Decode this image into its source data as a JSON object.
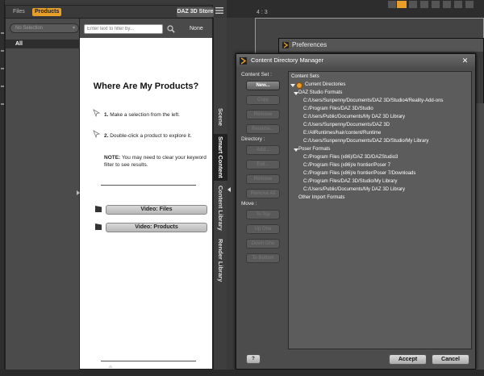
{
  "pane": {
    "tabs": {
      "files": "Files",
      "products": "Products"
    },
    "store_button": "DAZ 3D Store",
    "no_selection": "No Selection",
    "all_label": "All",
    "filter_placeholder": "Enter text to filter by...",
    "none_label": "None",
    "title": "Where Are My Products?",
    "step1": {
      "num": "1.",
      "text": "Make a selection from the left."
    },
    "step2": {
      "num": "2.",
      "text": "Double-click a product to explore it."
    },
    "note": {
      "label": "NOTE:",
      "text": "You may need to clear your keyword filter to see results."
    },
    "video_files": "Video: Files",
    "video_products": "Video: Products"
  },
  "side_tabs": [
    "Scene",
    "Smart Content",
    "Content Library",
    "Render Library"
  ],
  "viewport": {
    "aspect": "4 : 3"
  },
  "preferences": {
    "title": "Preferences"
  },
  "cdm": {
    "title": "Content Directory Manager",
    "content_set_label": "Content Set :",
    "directory_label": "Directory :",
    "move_label": "Move :",
    "buttons": {
      "new": "New...",
      "copy": "Copy",
      "remove_set": "Remove",
      "rename": "Rename...",
      "add": "Add...",
      "edit": "Edit...",
      "remove_dir": "Remove",
      "remove_all": "Remove All",
      "to_top": "To Top",
      "up_one": "Up One",
      "down_one": "Down One",
      "to_bottom": "To Bottom"
    },
    "tree": {
      "root": "Content Sets",
      "current": "Current Directories",
      "daz_formats": "DAZ Studio Formats",
      "daz_paths": [
        "C:/Users/Sunpenny/Documents/DAZ 3D/Studio4/Reality-Add-ons",
        "C:/Program Files/DAZ 3D/Studio",
        "C:/Users/Public/Documents/My DAZ 3D Library",
        "C:/Users/Sunpenny/Documents/DAZ 3D",
        "E:/AllRuntimes/hair/content/Runtime",
        "C:/Users/Sunpenny/Documents/DAZ 3D/Studio/My Library"
      ],
      "poser_formats": "Poser Formats",
      "poser_paths": [
        "C:/Program Files (x86)/DAZ 3D/DAZStudio3",
        "C:/Program Files (x86)/e frontier/Poser 7",
        "C:/Program Files (x86)/e frontier/Poser 7/Downloads",
        "C:/Program Files/DAZ 3D/Studio/My Library",
        "C:/Users/Public/Documents/My DAZ 3D Library"
      ],
      "other_formats": "Other Import Formats"
    },
    "help": "?",
    "accept": "Accept",
    "cancel": "Cancel"
  },
  "colors": {
    "accent": "#e79f2a",
    "panel": "#4c4c4c",
    "content_bg": "#ffffff"
  }
}
